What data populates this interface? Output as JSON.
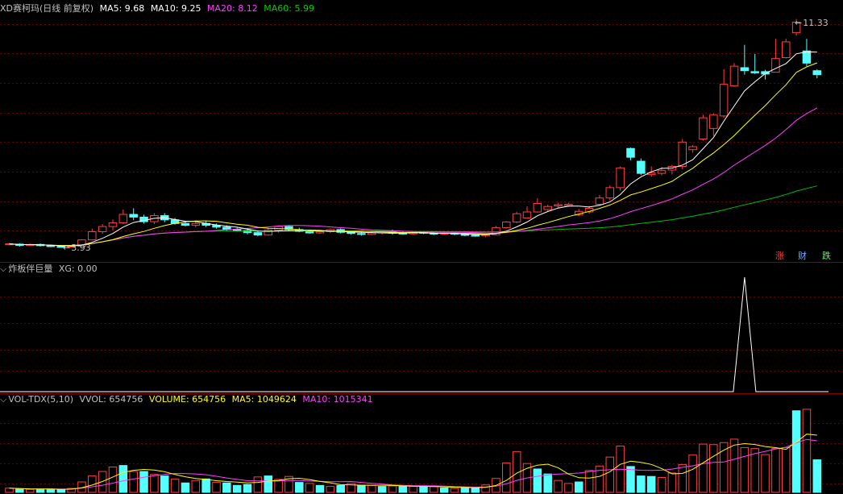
{
  "colors": {
    "bg": "#000000",
    "grid": "#6b0000",
    "divider": "#8a0000",
    "up": "#ff4040",
    "down": "#54ffff",
    "ma5": "#ffffff",
    "ma10": "#ffff00",
    "ma20": "#ff40ff",
    "ma60": "#00c000",
    "label": "#c0c0c0"
  },
  "price_panel": {
    "title": "XD赛柯玛(日线 前复权)",
    "ma5": "MA5: 9.68",
    "ma10": "MA10: 9.25",
    "ma20": "MA20: 8.12",
    "ma60": "MA60: 5.99",
    "high_label": "11.33",
    "low_label": "3.93",
    "tabs": [
      "涨",
      "财",
      "跌"
    ]
  },
  "indicator_panel": {
    "title": "炸板伴巨量",
    "xg": "XG: 0.00"
  },
  "volume_panel": {
    "title": "VOL-TDX(5,10)",
    "vvol": "VVOL: 654756",
    "volume": "VOLUME: 654756",
    "ma5": "MA5: 1049624",
    "ma10": "MA10: 1015341"
  },
  "chart_data": {
    "type": "candlestick",
    "price_range": [
      3.8,
      11.6
    ],
    "candles": [
      [
        4.02,
        4.05,
        4.0,
        4.08
      ],
      [
        4.04,
        4.0,
        3.96,
        4.07
      ],
      [
        4.0,
        4.03,
        3.98,
        4.06
      ],
      [
        4.03,
        3.99,
        3.96,
        4.06
      ],
      [
        3.99,
        3.96,
        3.94,
        4.02
      ],
      [
        3.96,
        3.94,
        3.93,
        3.99
      ],
      [
        3.94,
        3.97,
        3.93,
        3.99
      ],
      [
        3.97,
        4.18,
        3.96,
        4.2
      ],
      [
        4.18,
        4.45,
        4.16,
        4.55
      ],
      [
        4.45,
        4.62,
        4.38,
        4.7
      ],
      [
        4.62,
        4.74,
        4.5,
        4.85
      ],
      [
        4.74,
        5.02,
        4.7,
        5.18
      ],
      [
        5.02,
        4.93,
        4.83,
        5.22
      ],
      [
        4.93,
        4.78,
        4.72,
        5.01
      ],
      [
        4.78,
        4.98,
        4.7,
        5.06
      ],
      [
        4.98,
        4.84,
        4.76,
        5.06
      ],
      [
        4.84,
        4.72,
        4.68,
        4.9
      ],
      [
        4.72,
        4.66,
        4.62,
        4.8
      ],
      [
        4.66,
        4.72,
        4.6,
        4.78
      ],
      [
        4.72,
        4.66,
        4.6,
        4.8
      ],
      [
        4.66,
        4.6,
        4.55,
        4.72
      ],
      [
        4.6,
        4.52,
        4.48,
        4.66
      ],
      [
        4.52,
        4.49,
        4.45,
        4.58
      ],
      [
        4.49,
        4.42,
        4.36,
        4.55
      ],
      [
        4.42,
        4.34,
        4.3,
        4.49
      ],
      [
        4.34,
        4.5,
        4.32,
        4.58
      ],
      [
        4.5,
        4.62,
        4.42,
        4.66
      ],
      [
        4.62,
        4.52,
        4.46,
        4.66
      ],
      [
        4.52,
        4.46,
        4.43,
        4.58
      ],
      [
        4.46,
        4.41,
        4.38,
        4.52
      ],
      [
        4.41,
        4.45,
        4.37,
        4.5
      ],
      [
        4.45,
        4.52,
        4.41,
        4.56
      ],
      [
        4.52,
        4.43,
        4.39,
        4.56
      ],
      [
        4.43,
        4.39,
        4.35,
        4.47
      ],
      [
        4.39,
        4.36,
        4.32,
        4.44
      ],
      [
        4.36,
        4.41,
        4.34,
        4.44
      ],
      [
        4.41,
        4.46,
        4.36,
        4.5
      ],
      [
        4.46,
        4.4,
        4.35,
        4.52
      ],
      [
        4.4,
        4.38,
        4.35,
        4.45
      ],
      [
        4.38,
        4.43,
        4.35,
        4.46
      ],
      [
        4.43,
        4.4,
        4.37,
        4.46
      ],
      [
        4.4,
        4.37,
        4.34,
        4.44
      ],
      [
        4.37,
        4.4,
        4.34,
        4.42
      ],
      [
        4.4,
        4.37,
        4.33,
        4.42
      ],
      [
        4.37,
        4.33,
        4.3,
        4.4
      ],
      [
        4.33,
        4.31,
        4.28,
        4.37
      ],
      [
        4.31,
        4.35,
        4.27,
        4.38
      ],
      [
        4.35,
        4.58,
        4.33,
        4.64
      ],
      [
        4.58,
        4.77,
        4.55,
        4.8
      ],
      [
        4.77,
        5.04,
        4.73,
        5.1
      ],
      [
        4.9,
        5.1,
        4.9,
        5.28
      ],
      [
        5.1,
        5.38,
        5.08,
        5.55
      ],
      [
        5.18,
        5.28,
        5.12,
        5.34
      ],
      [
        5.3,
        5.34,
        5.22,
        5.4
      ],
      [
        5.31,
        5.35,
        5.27,
        5.4
      ],
      [
        5.0,
        5.12,
        4.96,
        5.2
      ],
      [
        5.1,
        5.22,
        5.04,
        5.3
      ],
      [
        5.35,
        5.56,
        5.3,
        5.66
      ],
      [
        5.56,
        5.9,
        5.48,
        5.98
      ],
      [
        5.9,
        6.55,
        5.8,
        6.6
      ],
      [
        7.19,
        6.9,
        6.8,
        7.22
      ],
      [
        6.77,
        6.37,
        6.31,
        6.86
      ],
      [
        6.33,
        6.39,
        6.26,
        6.6
      ],
      [
        6.37,
        6.46,
        6.31,
        6.58
      ],
      [
        6.48,
        6.6,
        6.34,
        6.65
      ],
      [
        6.6,
        7.4,
        6.5,
        7.5
      ],
      [
        7.15,
        7.25,
        7.05,
        7.3
      ],
      [
        7.5,
        8.2,
        7.45,
        8.3
      ],
      [
        7.85,
        8.29,
        7.6,
        8.35
      ],
      [
        8.26,
        9.3,
        8.2,
        9.8
      ],
      [
        9.25,
        9.9,
        9.22,
        10.0
      ],
      [
        9.85,
        9.75,
        9.62,
        10.6
      ],
      [
        9.72,
        9.68,
        9.64,
        10.3
      ],
      [
        9.72,
        9.64,
        9.46,
        9.78
      ],
      [
        9.7,
        10.15,
        9.7,
        10.8
      ],
      [
        10.18,
        10.7,
        10.15,
        10.8
      ],
      [
        11.0,
        11.35,
        10.9,
        11.45
      ],
      [
        10.4,
        10.0,
        9.9,
        10.8
      ],
      [
        9.75,
        9.62,
        9.5,
        9.8
      ]
    ],
    "volume_range": [
      0,
      1700000
    ],
    "volumes": [
      [
        85000,
        1
      ],
      [
        70000,
        0
      ],
      [
        60000,
        1
      ],
      [
        65000,
        0
      ],
      [
        60000,
        0
      ],
      [
        55000,
        0
      ],
      [
        80000,
        1
      ],
      [
        210000,
        1
      ],
      [
        330000,
        1
      ],
      [
        420000,
        1
      ],
      [
        510000,
        1
      ],
      [
        540000,
        0
      ],
      [
        420000,
        1
      ],
      [
        420000,
        0
      ],
      [
        360000,
        1
      ],
      [
        330000,
        0
      ],
      [
        270000,
        1
      ],
      [
        190000,
        0
      ],
      [
        240000,
        1
      ],
      [
        270000,
        0
      ],
      [
        200000,
        1
      ],
      [
        190000,
        0
      ],
      [
        140000,
        0
      ],
      [
        160000,
        0
      ],
      [
        310000,
        1
      ],
      [
        330000,
        0
      ],
      [
        260000,
        1
      ],
      [
        320000,
        1
      ],
      [
        200000,
        0
      ],
      [
        180000,
        1
      ],
      [
        140000,
        0
      ],
      [
        120000,
        1
      ],
      [
        140000,
        0
      ],
      [
        180000,
        1
      ],
      [
        140000,
        0
      ],
      [
        140000,
        1
      ],
      [
        120000,
        0
      ],
      [
        130000,
        1
      ],
      [
        120000,
        0
      ],
      [
        120000,
        1
      ],
      [
        110000,
        0
      ],
      [
        115000,
        1
      ],
      [
        90000,
        0
      ],
      [
        80000,
        1
      ],
      [
        100000,
        0
      ],
      [
        85000,
        0
      ],
      [
        150000,
        1
      ],
      [
        280000,
        1
      ],
      [
        590000,
        1
      ],
      [
        820000,
        1
      ],
      [
        580000,
        1
      ],
      [
        470000,
        0
      ],
      [
        370000,
        0
      ],
      [
        240000,
        1
      ],
      [
        180000,
        1
      ],
      [
        210000,
        0
      ],
      [
        440000,
        1
      ],
      [
        530000,
        1
      ],
      [
        710000,
        1
      ],
      [
        930000,
        1
      ],
      [
        520000,
        0
      ],
      [
        330000,
        0
      ],
      [
        320000,
        0
      ],
      [
        300000,
        1
      ],
      [
        390000,
        1
      ],
      [
        560000,
        1
      ],
      [
        750000,
        1
      ],
      [
        970000,
        1
      ],
      [
        960000,
        1
      ],
      [
        1000000,
        1
      ],
      [
        1070000,
        1
      ],
      [
        900000,
        1
      ],
      [
        880000,
        1
      ],
      [
        760000,
        1
      ],
      [
        880000,
        1
      ],
      [
        900000,
        1
      ],
      [
        1640000,
        0
      ],
      [
        1670000,
        1
      ],
      [
        654756,
        0
      ]
    ],
    "xg_signal_index": 71
  }
}
